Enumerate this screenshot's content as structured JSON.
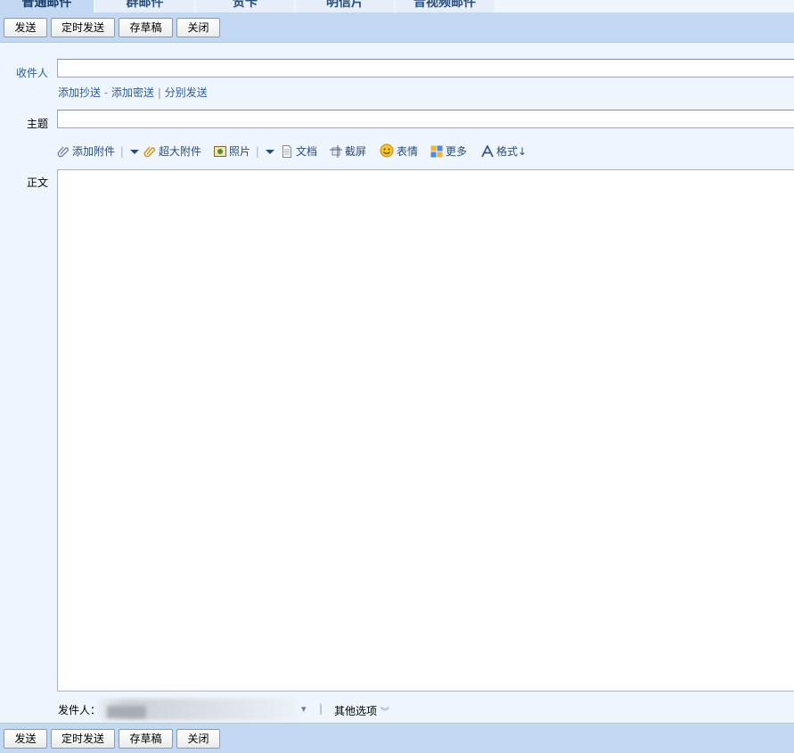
{
  "tabs": [
    {
      "label": "普通邮件",
      "active": true
    },
    {
      "label": "群邮件",
      "active": false
    },
    {
      "label": "贺卡",
      "active": false
    },
    {
      "label": "明信片",
      "active": false
    },
    {
      "label": "音视频邮件",
      "active": false
    }
  ],
  "toolbar": {
    "send": "发送",
    "scheduled_send": "定时发送",
    "save_draft": "存草稿",
    "close": "关闭"
  },
  "compose": {
    "to_label": "收件人",
    "to_value": "",
    "add_cc": "添加抄送",
    "add_bcc": "添加密送",
    "separate_send": "分别发送",
    "link_sep_dash": "-",
    "link_sep_bar": "|",
    "subject_label": "主题",
    "subject_value": "",
    "body_label": "正文",
    "body_value": ""
  },
  "attach_tools": [
    {
      "label": "添加附件",
      "icon": "paperclip-icon",
      "has_dropdown": true
    },
    {
      "label": "超大附件",
      "icon": "large-attachment-icon",
      "has_dropdown": false
    },
    {
      "label": "照片",
      "icon": "photo-icon",
      "has_dropdown": true
    },
    {
      "label": "文档",
      "icon": "document-icon",
      "has_dropdown": false
    },
    {
      "label": "截屏",
      "icon": "screenshot-icon",
      "has_dropdown": false
    },
    {
      "label": "表情",
      "icon": "smiley-icon",
      "has_dropdown": false
    },
    {
      "label": "更多",
      "icon": "more-grid-icon",
      "has_dropdown": false
    },
    {
      "label": "格式↓",
      "icon": "format-a-icon",
      "has_dropdown": false
    }
  ],
  "footer": {
    "sender_label": "发件人：",
    "sender_value_redacted": true,
    "sep": "|",
    "other_options": "其他选项"
  },
  "colors": {
    "toolbar_bg": "#c3d9f3",
    "page_bg": "#eff5fc",
    "link_blue": "#2b5d93"
  }
}
